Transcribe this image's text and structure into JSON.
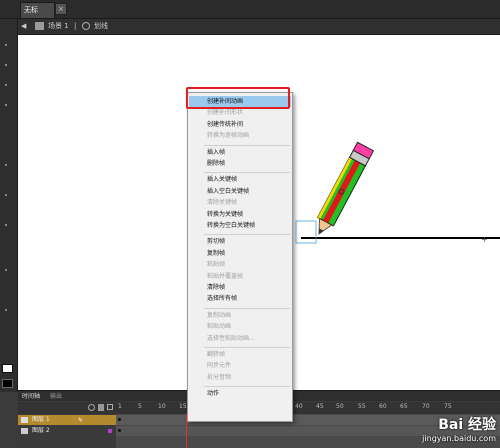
{
  "window": {
    "doc_tab": "无标题-1*",
    "close_glyph": "×"
  },
  "breadcrumb": {
    "scene": "场景 1",
    "sep": "|",
    "item": "划线"
  },
  "context_menu": {
    "items": [
      {
        "label": "创建补间动画",
        "disabled": false,
        "highlighted": true
      },
      {
        "label": "创建补间形状",
        "disabled": true
      },
      {
        "label": "创建传统补间",
        "disabled": false
      },
      {
        "label": "转换为逐帧动画",
        "disabled": true
      },
      {
        "sep": true
      },
      {
        "label": "插入帧",
        "disabled": false
      },
      {
        "label": "删除帧",
        "disabled": false
      },
      {
        "sep": true
      },
      {
        "label": "插入关键帧",
        "disabled": false
      },
      {
        "label": "插入空白关键帧",
        "disabled": false
      },
      {
        "label": "清除关键帧",
        "disabled": true
      },
      {
        "label": "转换为关键帧",
        "disabled": false
      },
      {
        "label": "转换为空白关键帧",
        "disabled": false
      },
      {
        "sep": true
      },
      {
        "label": "剪切帧",
        "disabled": false
      },
      {
        "label": "复制帧",
        "disabled": false
      },
      {
        "label": "粘贴帧",
        "disabled": true
      },
      {
        "label": "粘贴并覆盖帧",
        "disabled": true
      },
      {
        "label": "清除帧",
        "disabled": false
      },
      {
        "label": "选择所有帧",
        "disabled": false
      },
      {
        "sep": true
      },
      {
        "label": "复制动画",
        "disabled": true
      },
      {
        "label": "粘贴动画",
        "disabled": true
      },
      {
        "label": "选择性粘贴动画...",
        "disabled": true
      },
      {
        "sep": true
      },
      {
        "label": "翻转帧",
        "disabled": true
      },
      {
        "label": "同步元件",
        "disabled": true
      },
      {
        "label": "拆分音频",
        "disabled": true
      },
      {
        "sep": true
      },
      {
        "label": "动作",
        "disabled": false
      }
    ]
  },
  "timeline": {
    "tabs": [
      "时间轴",
      "输出"
    ],
    "layers": [
      {
        "name": "图层 1",
        "selected": true
      },
      {
        "name": "图层 2",
        "selected": false
      }
    ],
    "frame_numbers": [
      "1",
      "5",
      "10",
      "15",
      "40",
      "45",
      "50",
      "55",
      "60",
      "65",
      "70",
      "75"
    ]
  },
  "watermark": {
    "brand": "Bai 经验",
    "url": "jingyan.baidu.com"
  },
  "colors": {
    "highlight": "#99c9ef",
    "red_box": "#e02020",
    "pencil_green": "#22c022",
    "pencil_red": "#e01818",
    "pencil_yellow": "#f6d800",
    "pencil_pink": "#ff3fa6"
  }
}
